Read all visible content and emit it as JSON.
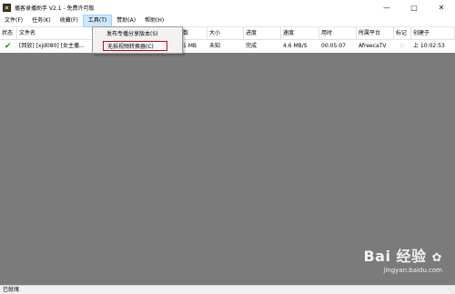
{
  "window": {
    "title": "播客录播助手 V2.1 - 免费许可版",
    "icon": "app-icon",
    "controls": [
      "minimize-icon",
      "maximize-icon",
      "close-icon"
    ]
  },
  "menu": [
    "文件(F)",
    "任务(K)",
    "收藏(F)",
    "工具(T)",
    "赞助(A)",
    "帮助(H)"
  ],
  "tools_menu": {
    "items": [
      "发布专播分享版本(S)",
      "无损视频转换器(C)"
    ],
    "highlighted_index": 1,
    "highlight_color": "#d0021b"
  },
  "table": {
    "headers": [
      "状态",
      "文件名",
      "数",
      "大小",
      "进度",
      "速度",
      "用时",
      "所属平台",
      "标记",
      "创建于"
    ],
    "rows": [
      {
        "status_icon": "check-icon",
        "filename": "[回放] [xjd080] [女主播...",
        "count": "1 MB",
        "size": "未知",
        "progress": "完成",
        "speed": "4.6 MB/S",
        "elapsed": "00:05:07",
        "platform": "AfreecaTV",
        "mark_icon": "flag-icon",
        "created": "上 10:02:53"
      }
    ]
  },
  "status": "已就绪",
  "watermark": {
    "logo": "Bai 经验",
    "url": "jingyan.baidu.com"
  },
  "colors": {
    "workspace": "#7b7b7b",
    "menu_active": "#cce8ff",
    "check": "#1a8f1a"
  }
}
